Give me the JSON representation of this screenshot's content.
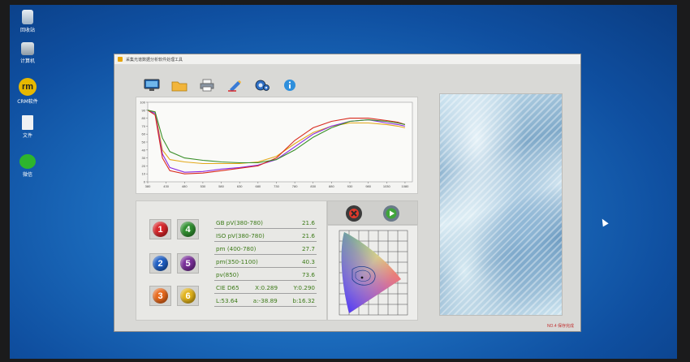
{
  "window": {
    "title": "采集光谱数据分析软件处理工具",
    "status": "NO.4 保存完成"
  },
  "desktop": {
    "icons": [
      {
        "name": "recycle-bin",
        "label": "回收站"
      },
      {
        "name": "computer",
        "label": "计算机"
      },
      {
        "name": "rm-app",
        "label": "CRM软件"
      },
      {
        "name": "document",
        "label": "文件"
      },
      {
        "name": "wechat",
        "label": "微信"
      }
    ]
  },
  "toolbar": {
    "buttons": [
      {
        "name": "monitor-button",
        "icon": "monitor-icon"
      },
      {
        "name": "open-folder-button",
        "icon": "folder-icon"
      },
      {
        "name": "print-button",
        "icon": "printer-icon"
      },
      {
        "name": "edit-button",
        "icon": "pencil-icon"
      },
      {
        "name": "settings-button",
        "icon": "gears-icon"
      },
      {
        "name": "info-button",
        "icon": "info-icon"
      }
    ]
  },
  "number_buttons": [
    {
      "label": "1",
      "color": "#d8262a"
    },
    {
      "label": "4",
      "color": "#2f8f2f"
    },
    {
      "label": "2",
      "color": "#1f5fc4"
    },
    {
      "label": "5",
      "color": "#7a2f9a"
    },
    {
      "label": "3",
      "color": "#e8691c"
    },
    {
      "label": "6",
      "color": "#e1b21a"
    }
  ],
  "metrics": [
    {
      "label": "GB pV(380-780)",
      "value": "21.6"
    },
    {
      "label": "ISO pV(380-780)",
      "value": "21.6"
    },
    {
      "label": "pm (400-780)",
      "value": "27.7"
    },
    {
      "label": "pm(350-1100)",
      "value": "40.3"
    },
    {
      "label": "pv(850)",
      "value": "73.6"
    }
  ],
  "cie": {
    "row1": [
      "CIE D65",
      "X:0.289",
      "Y:0.290"
    ],
    "row2": [
      "L:53.64",
      "a:-38.89",
      "b:16.32"
    ]
  },
  "colors": {
    "accent_green": "#3c7a18",
    "series": [
      "#e3a91a",
      "#8a2be2",
      "#d82a1e",
      "#3a8f2a"
    ]
  },
  "chart_data": {
    "type": "line",
    "xlim": [
      380,
      1100
    ],
    "ylim": [
      0,
      100
    ],
    "yticks": [
      "0",
      "10",
      "20",
      "30",
      "40",
      "50",
      "60",
      "70",
      "80",
      "90",
      "100"
    ],
    "xticks": [
      "380",
      "430",
      "480",
      "530",
      "580",
      "630",
      "680",
      "730",
      "780",
      "830",
      "880",
      "930",
      "980",
      "1030",
      "1080"
    ],
    "x": [
      380,
      400,
      420,
      440,
      480,
      530,
      580,
      630,
      680,
      730,
      780,
      830,
      880,
      930,
      980,
      1030,
      1060,
      1080
    ],
    "series": [
      {
        "color": "#e3a91a",
        "values": [
          90,
          88,
          40,
          28,
          25,
          23,
          23,
          23,
          25,
          32,
          48,
          62,
          70,
          74,
          74,
          72,
          70,
          68
        ]
      },
      {
        "color": "#8a2be2",
        "values": [
          90,
          86,
          35,
          18,
          12,
          13,
          16,
          18,
          21,
          28,
          44,
          60,
          70,
          76,
          78,
          74,
          72,
          70
        ]
      },
      {
        "color": "#d82a1e",
        "values": [
          90,
          84,
          30,
          14,
          10,
          11,
          14,
          17,
          20,
          30,
          52,
          68,
          76,
          80,
          80,
          77,
          75,
          72
        ]
      },
      {
        "color": "#3a8f2a",
        "values": [
          90,
          88,
          55,
          38,
          30,
          27,
          25,
          24,
          24,
          28,
          40,
          56,
          68,
          76,
          78,
          76,
          74,
          72
        ]
      }
    ]
  }
}
